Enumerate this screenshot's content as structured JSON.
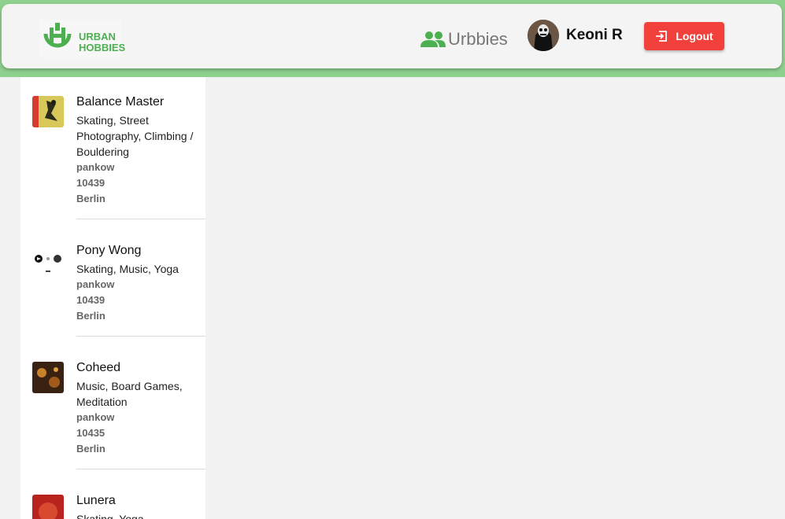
{
  "brand": {
    "line1": "URBAN",
    "line2": "HOBBIES",
    "color": "#4caf50"
  },
  "nav": {
    "urbbies_label": "Urbbies"
  },
  "user": {
    "name": "Keoni R"
  },
  "logout": {
    "label": "Logout",
    "color": "#f2413c"
  },
  "items": [
    {
      "name": "Balance Master",
      "hobbies": "Skating, Street Photography, Climbing / Bouldering",
      "district": "pankow",
      "zip": "10439",
      "city": "Berlin"
    },
    {
      "name": "Pony Wong",
      "hobbies": "Skating, Music, Yoga",
      "district": "pankow",
      "zip": "10439",
      "city": "Berlin"
    },
    {
      "name": "Coheed",
      "hobbies": "Music, Board Games, Meditation",
      "district": "pankow",
      "zip": "10435",
      "city": "Berlin"
    },
    {
      "name": "Lunera",
      "hobbies": "Skating, Yoga",
      "district": "",
      "zip": "",
      "city": ""
    }
  ]
}
